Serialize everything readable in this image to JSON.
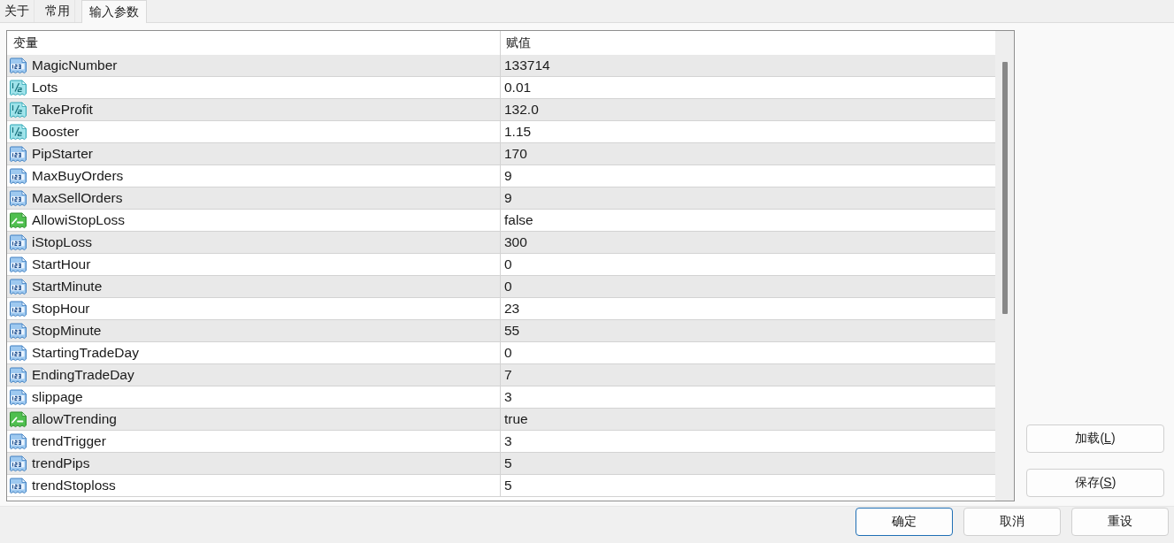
{
  "tabs": [
    {
      "label": "关于",
      "selected": false
    },
    {
      "label": "常用",
      "selected": false
    },
    {
      "label": "输入参数",
      "selected": true
    }
  ],
  "parameters": {
    "columns": [
      "变量",
      "赋值"
    ],
    "rows": [
      {
        "kind": "int",
        "name": "MagicNumber",
        "value": "133714"
      },
      {
        "kind": "double",
        "name": "Lots",
        "value": "0.01"
      },
      {
        "kind": "double",
        "name": "TakeProfit",
        "value": "132.0"
      },
      {
        "kind": "double",
        "name": "Booster",
        "value": "1.15"
      },
      {
        "kind": "int",
        "name": "PipStarter",
        "value": "170"
      },
      {
        "kind": "int",
        "name": "MaxBuyOrders",
        "value": "9"
      },
      {
        "kind": "int",
        "name": "MaxSellOrders",
        "value": "9"
      },
      {
        "kind": "bool",
        "name": "AllowiStopLoss",
        "value": "false"
      },
      {
        "kind": "int",
        "name": "iStopLoss",
        "value": "300"
      },
      {
        "kind": "int",
        "name": "StartHour",
        "value": "0"
      },
      {
        "kind": "int",
        "name": "StartMinute",
        "value": "0"
      },
      {
        "kind": "int",
        "name": "StopHour",
        "value": "23"
      },
      {
        "kind": "int",
        "name": "StopMinute",
        "value": "55"
      },
      {
        "kind": "int",
        "name": "StartingTradeDay",
        "value": "0"
      },
      {
        "kind": "int",
        "name": "EndingTradeDay",
        "value": "7"
      },
      {
        "kind": "int",
        "name": "slippage",
        "value": "3"
      },
      {
        "kind": "bool",
        "name": "allowTrending",
        "value": "true"
      },
      {
        "kind": "int",
        "name": "trendTrigger",
        "value": "3"
      },
      {
        "kind": "int",
        "name": "trendPips",
        "value": "5"
      },
      {
        "kind": "int",
        "name": "trendStoploss",
        "value": "5"
      }
    ]
  },
  "side_buttons": [
    {
      "label": "加载(",
      "access_key": "L",
      "label_end": ")"
    },
    {
      "label": "保存(",
      "access_key": "S",
      "label_end": ")"
    }
  ],
  "footer_buttons": [
    {
      "label": "确定",
      "default": true
    },
    {
      "label": "取消",
      "default": false
    },
    {
      "label": "重设",
      "default": false
    }
  ]
}
